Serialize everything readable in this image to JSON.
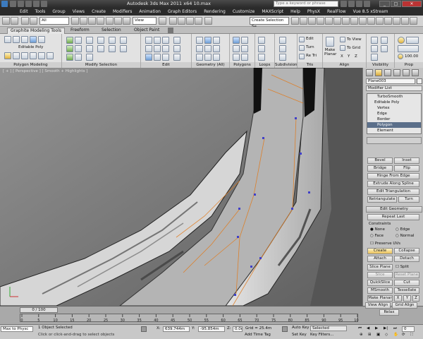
{
  "window": {
    "title": "Autodesk 3ds Max  2011 x64      10.max",
    "search_placeholder": "Type a keyword or phrase"
  },
  "menu": [
    "Edit",
    "Tools",
    "Group",
    "Views",
    "Create",
    "Modifiers",
    "Animation",
    "Graph Editors",
    "Rendering",
    "Customize",
    "MAXScript",
    "Help",
    "PhysX",
    "RealFlow",
    "Vue 8.5 xStream"
  ],
  "maintoolbar": {
    "selection_filter": "All",
    "ref_coord": "View",
    "named_selection": "Create Selection Se"
  },
  "ribbon_tabs": [
    "Graphite Modeling Tools",
    "Freeform",
    "Selection",
    "Object Paint"
  ],
  "ribbon": {
    "editable_poly": "Editable Poly",
    "groups": [
      "Polygon Modeling",
      "Modify Selection",
      "Edit",
      "Geometry (All)",
      "Polygons",
      "Loops",
      "Subdivision",
      "Tris",
      "Align",
      "Visibility",
      "Prop"
    ],
    "edit_items": [
      "Edit",
      "Turn",
      "Re Tri"
    ],
    "make_planar": "Make Planar",
    "align_items": [
      "To View",
      "To Grid"
    ],
    "align_xyz": [
      "X",
      "Y",
      "Z"
    ],
    "props_value": "100.00"
  },
  "viewport": {
    "label": "[ + ] [ Perspective ] [ Smooth + Highlights ]"
  },
  "command_panel": {
    "object_name": "Plane003",
    "modifier_list": "Modifier List",
    "stack": [
      "TurboSmooth",
      "Editable Poly",
      "Vertex",
      "Edge",
      "Border",
      "Polygon",
      "Element"
    ],
    "selected_stack_item": "Polygon",
    "buttons_a": [
      [
        "Bevel",
        "Inset"
      ],
      [
        "Bridge",
        "Flip"
      ],
      [
        "Hinge From Edge"
      ],
      [
        "Extrude Along Spline"
      ],
      [
        "Edit Triangulation"
      ],
      [
        "Retriangulate",
        "Turn"
      ]
    ],
    "rollout_edit_geometry": "Edit Geometry",
    "repeat_last": "Repeat Last",
    "constraints_label": "Constraints",
    "constraints": [
      "None",
      "Edge",
      "Face",
      "Normal"
    ],
    "preserve_uvs": "Preserve UVs",
    "buttons_b": [
      [
        "Create",
        "Collapse"
      ],
      [
        "Attach",
        "Detach"
      ]
    ],
    "slice_plane": "Slice Plane",
    "split": "Split",
    "slice": "Slice",
    "reset_plane": "Reset Plane",
    "quickslice": "QuickSlice",
    "cut": "Cut",
    "msmooth": "MSmooth",
    "tessellate": "Tessellate",
    "make_planar": "Make Planar",
    "xyz": [
      "X",
      "Y",
      "Z"
    ],
    "view_align": "View Align",
    "grid_align": "Grid Align",
    "relax": "Relax"
  },
  "timeline": {
    "position": "0 / 100",
    "ticks": [
      "0",
      "5",
      "10",
      "15",
      "20",
      "25",
      "30",
      "35",
      "40",
      "45",
      "50",
      "55",
      "60",
      "65",
      "70",
      "75",
      "80",
      "85",
      "90",
      "95",
      "100"
    ]
  },
  "status": {
    "maxscript": "Max to Physc",
    "selected": "1 Object Selected",
    "prompt": "Click or click-and-drag to select objects",
    "x_label": "X:",
    "x": "639.744m",
    "y_label": "Y:",
    "y": "-95.854m",
    "z_label": "Z:",
    "z": "0.0m",
    "grid": "Grid = 25.4m",
    "autokey": "Auto Key",
    "autokey_mode": "Selected",
    "setkey": "Set Key",
    "keyfilters": "Key Filters...",
    "addtimetag": "Add Time Tag",
    "frame": "0"
  }
}
